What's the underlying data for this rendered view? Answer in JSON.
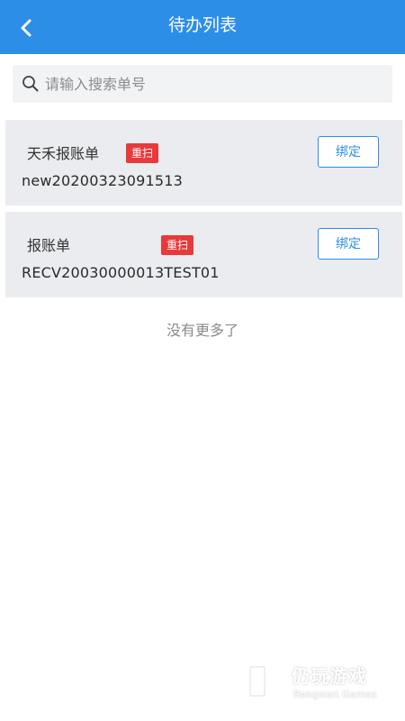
{
  "header": {
    "title": "待办列表",
    "back_icon": "chevron-left-icon",
    "background_color": "#2d8ee8"
  },
  "search": {
    "placeholder": "请输入搜索单号",
    "value": "",
    "icon": "search-icon"
  },
  "items": [
    {
      "title": "天禾报账单",
      "badge": "重扫",
      "number": "new20200323091513",
      "action_label": "绑定"
    },
    {
      "title": "报账单",
      "badge": "重扫",
      "number": "RECV20030000013TEST01",
      "action_label": "绑定"
    }
  ],
  "list_end_text": "没有更多了",
  "colors": {
    "accent": "#2d8ee8",
    "badge": "#e83a3a",
    "card_bg": "#ebecef"
  },
  "watermark": {
    "cn": "仍玩游戏",
    "en": "Rengwan Games"
  }
}
